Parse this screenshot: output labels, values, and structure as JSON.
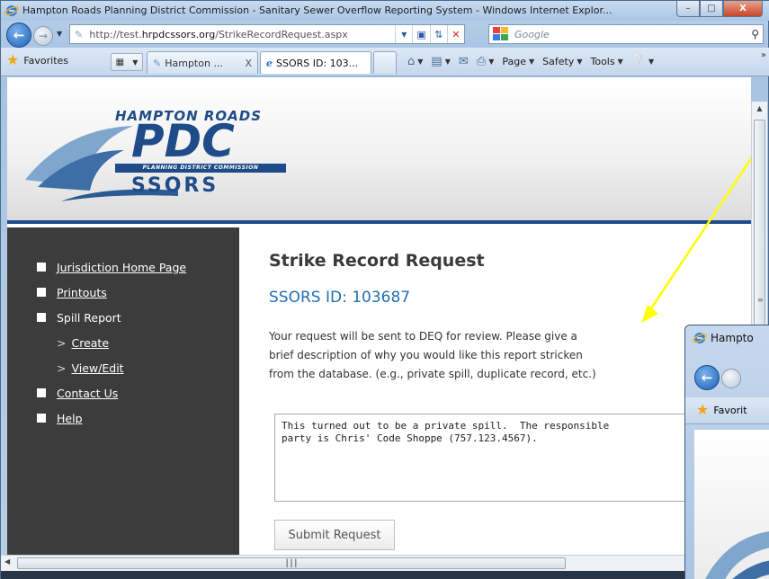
{
  "window": {
    "title": "Hampton Roads Planning District Commission - Sanitary Sewer Overflow Reporting System - Windows Internet Explor...",
    "minimize_glyph": "–",
    "maximize_glyph": "□",
    "close_glyph": "X"
  },
  "address_bar": {
    "url_prefix": "http://test.",
    "url_domain": "hrpdcssors.org",
    "url_path": "/StrikeRecordRequest.aspx",
    "search_placeholder": "Google"
  },
  "favorites_bar": {
    "favorites_label": "Favorites",
    "tabs": [
      {
        "label": "Hampton ...",
        "close": "X"
      },
      {
        "label": "SSORS ID: 103..."
      }
    ],
    "commands": [
      {
        "label": "Page"
      },
      {
        "label": "Safety"
      },
      {
        "label": "Tools"
      }
    ]
  },
  "logo": {
    "line1": "HAMPTON ROADS",
    "line2": "PDC",
    "line3": "PLANNING DISTRICT COMMISSION",
    "line4": "SSORS"
  },
  "sidebar": {
    "items": [
      {
        "label": "Jurisdiction Home Page",
        "link": true
      },
      {
        "label": "Printouts",
        "link": true
      },
      {
        "label": "Spill Report",
        "link": false
      },
      {
        "label": "Create",
        "link": true,
        "sub": true
      },
      {
        "label": "View/Edit",
        "link": true,
        "sub": true
      },
      {
        "label": "Contact Us",
        "link": true
      },
      {
        "label": "Help",
        "link": true
      }
    ]
  },
  "main": {
    "title": "Strike Record Request",
    "ssors_id": "SSORS ID: 103687",
    "description_lines": [
      "Your request will be sent to DEQ for review. Please give a",
      "brief description of why you would like this report stricken",
      "from the database. (e.g., private spill, duplicate record, etc.)"
    ],
    "reason_text": "This turned out to be a private spill.  The responsible\nparty is Chris' Code Shoppe (757.123.4567).",
    "submit_label": "Submit Request"
  },
  "overlay_window": {
    "title": "Hampto",
    "favorites_label": "Favorit"
  },
  "colors": {
    "sidebar_bg": "#3c3c3c",
    "ssors_id_blue": "#1f6fb2",
    "header_rule": "#1f4b88",
    "annotation_arrow": "#ffff00"
  }
}
